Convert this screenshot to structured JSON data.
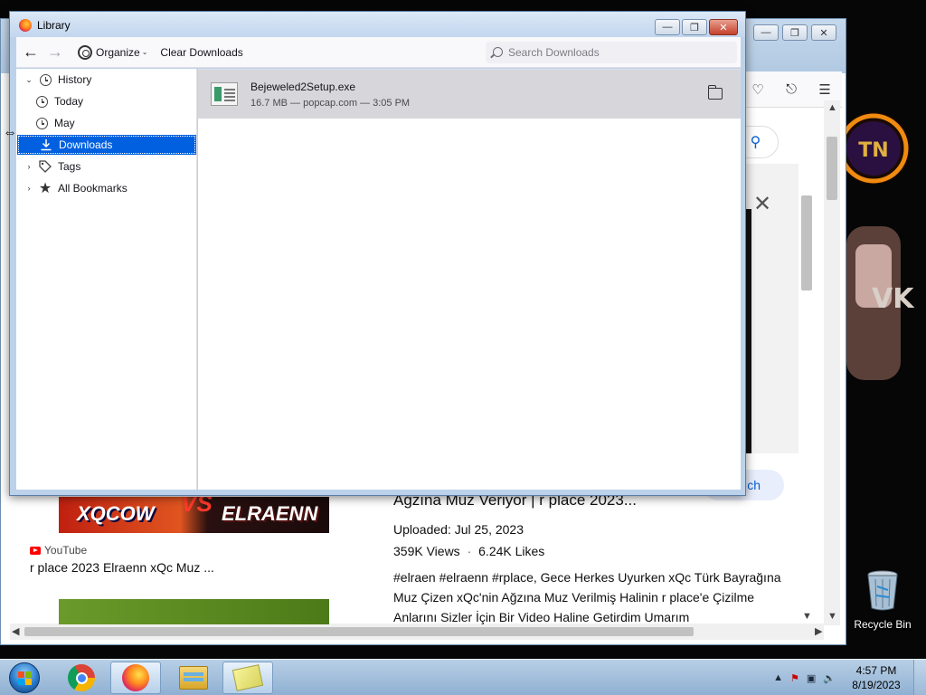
{
  "library": {
    "title": "Library",
    "toolbar": {
      "organize_label": "Organize",
      "clear_label": "Clear Downloads",
      "search_placeholder": "Search Downloads"
    },
    "sidebar": {
      "history": "History",
      "today": "Today",
      "may": "May",
      "downloads": "Downloads",
      "tags": "Tags",
      "all_bookmarks": "All Bookmarks"
    },
    "downloads": [
      {
        "name": "Bejeweled2Setup.exe",
        "status": "16.7 MB — popcap.com — 3:05 PM"
      }
    ]
  },
  "browser": {
    "card": {
      "thumb_left": "XQCOW",
      "thumb_vs": "VS",
      "thumb_right": "ELRAENN",
      "source": "YouTube",
      "title": "r place 2023 Elraenn xQc Muz ..."
    },
    "video": {
      "title": "Ağzına Muz Veriyor | r place 2023...",
      "uploaded": "Uploaded: Jul 25, 2023",
      "views": "359K Views",
      "likes": "6.24K Likes",
      "description": "#elraen #elraenn #rplace, Gece Herkes Uyurken xQc Türk Bayrağına Muz Çizen xQc'nin Ağzına Muz Verilmiş Halinin r place'e Çizilme Anlarını Sizler İçin Bir Video Haline Getirdim Umarım"
    },
    "search_button": "ch"
  },
  "desktop": {
    "recycle_bin": "Recycle Bin",
    "bg_badge": "TN",
    "bg_text": "VK"
  },
  "taskbar": {
    "time": "4:57 PM",
    "date": "8/19/2023"
  }
}
